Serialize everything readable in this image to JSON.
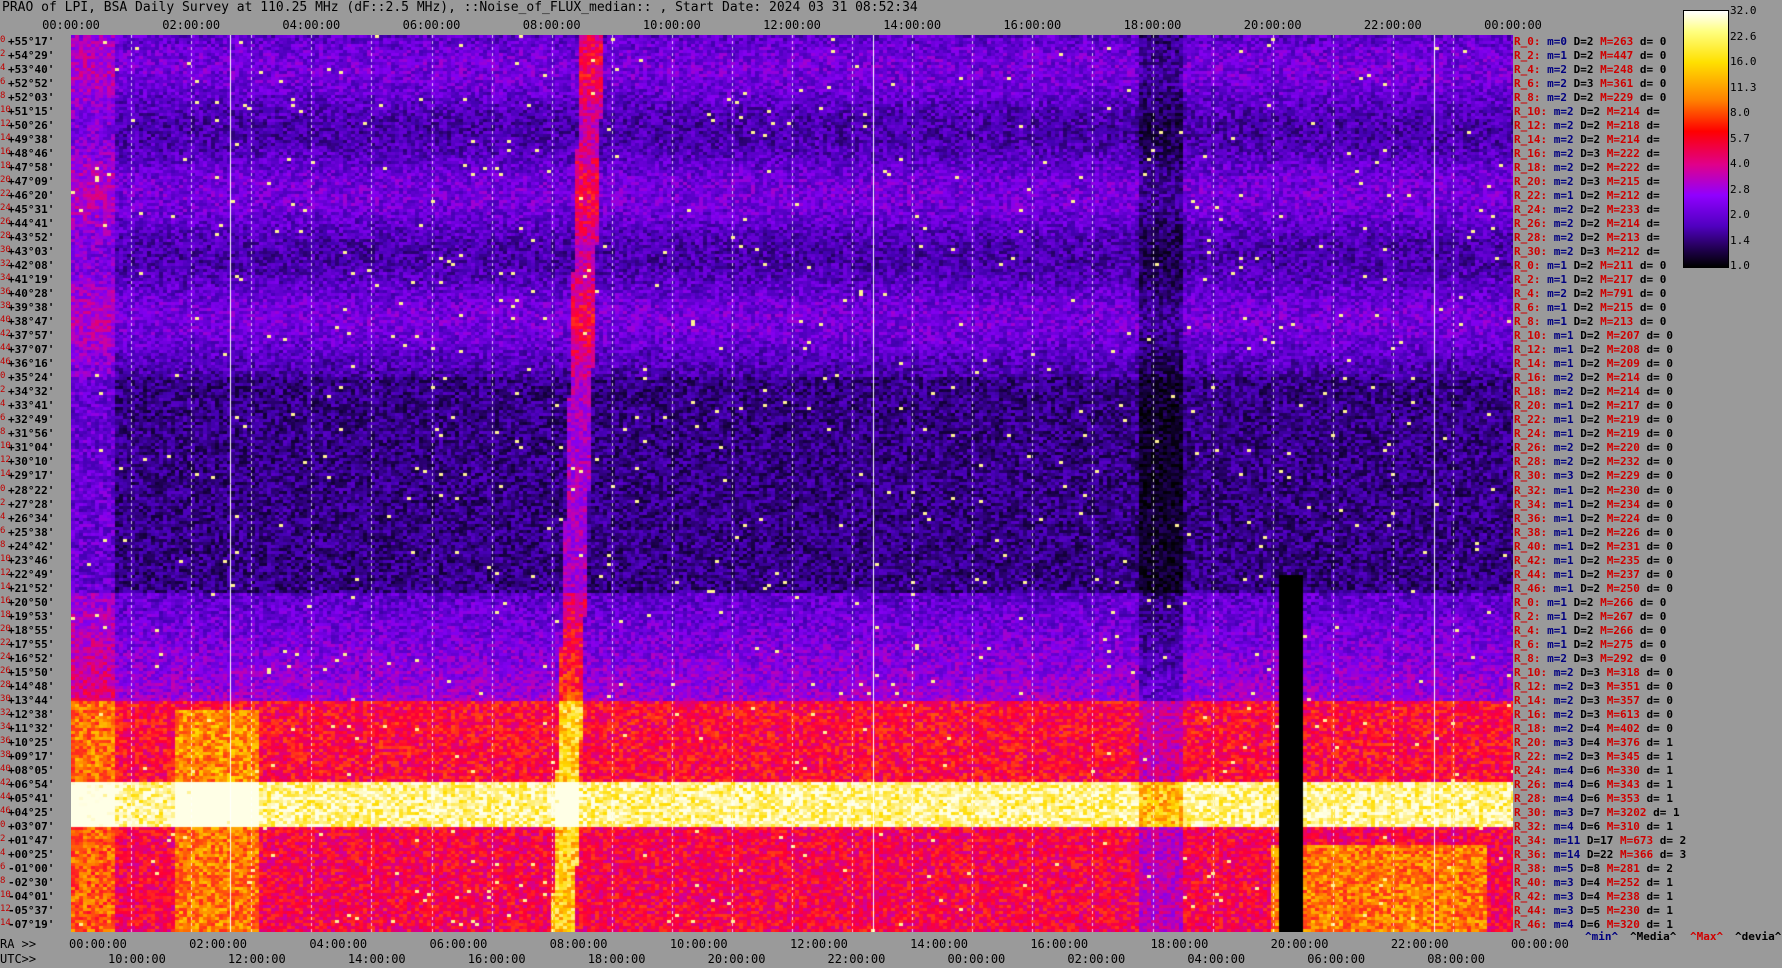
{
  "title": "PRAO of LPI, BSA Daily Survey at 110.25 MHz (dF::2.5 MHz), ::Noise_of_FLUX_median:: , Start Date: 2024 03 31 08:52:34",
  "top_time_ticks": [
    "00:00:00",
    "02:00:00",
    "04:00:00",
    "06:00:00",
    "08:00:00",
    "10:00:00",
    "12:00:00",
    "14:00:00",
    "16:00:00",
    "18:00:00",
    "20:00:00",
    "22:00:00",
    "00:00:00"
  ],
  "ra_label": "RA >>",
  "utc_label": "UTC>>",
  "bottom_ra_ticks": [
    "00:00:00",
    "02:00:00",
    "04:00:00",
    "06:00:00",
    "08:00:00",
    "10:00:00",
    "12:00:00",
    "14:00:00",
    "16:00:00",
    "18:00:00",
    "20:00:00",
    "22:00:00",
    "00:00:00"
  ],
  "bottom_utc_ticks": [
    "10:00:00",
    "12:00:00",
    "14:00:00",
    "16:00:00",
    "18:00:00",
    "20:00:00",
    "22:00:00",
    "00:00:00",
    "02:00:00",
    "04:00:00",
    "06:00:00",
    "08:00:00"
  ],
  "declinations": [
    "+55°17'",
    "+54°29'",
    "+53°40'",
    "+52°52'",
    "+52°03'",
    "+51°15'",
    "+50°26'",
    "+49°38'",
    "+48°46'",
    "+47°58'",
    "+47°09'",
    "+46°20'",
    "+45°31'",
    "+44°41'",
    "+43°52'",
    "+43°03'",
    "+42°08'",
    "+41°19'",
    "+40°28'",
    "+39°38'",
    "+38°47'",
    "+37°57'",
    "+37°07'",
    "+36°16'",
    "+35°24'",
    "+34°32'",
    "+33°41'",
    "+32°49'",
    "+31°56'",
    "+31°04'",
    "+30°10'",
    "+29°17'",
    "+28°22'",
    "+27°28'",
    "+26°34'",
    "+25°38'",
    "+24°42'",
    "+23°46'",
    "+22°49'",
    "+21°52'",
    "+20°50'",
    "+19°53'",
    "+18°55'",
    "+17°55'",
    "+16°52'",
    "+15°50'",
    "+14°48'",
    "+13°44'",
    "+12°38'",
    "+11°32'",
    "+10°25'",
    "+09°17'",
    "+08°05'",
    "+06°54'",
    "+05°41'",
    "+04°25'",
    "+03°07'",
    "+01°47'",
    "+00°25'",
    "-01°00'",
    "-02°30'",
    "-04°01'",
    "-05°37'",
    "-07°19'"
  ],
  "row_stats": [
    {
      "r": "R_0:",
      "m": "m=0",
      "D": "D=2",
      "M": "M=263",
      "d": "d= 0"
    },
    {
      "r": "R_2:",
      "m": "m=1",
      "D": "D=2",
      "M": "M=447",
      "d": "d= 0"
    },
    {
      "r": "R_4:",
      "m": "m=2",
      "D": "D=2",
      "M": "M=248",
      "d": "d= 0"
    },
    {
      "r": "R_6:",
      "m": "m=2",
      "D": "D=3",
      "M": "M=361",
      "d": "d= 0"
    },
    {
      "r": "R_8:",
      "m": "m=2",
      "D": "D=2",
      "M": "M=229",
      "d": "d= 0"
    },
    {
      "r": "R_10:",
      "m": "m=2",
      "D": "D=2",
      "M": "M=214",
      "d": "d="
    },
    {
      "r": "R_12:",
      "m": "m=2",
      "D": "D=2",
      "M": "M=218",
      "d": "d="
    },
    {
      "r": "R_14:",
      "m": "m=2",
      "D": "D=2",
      "M": "M=214",
      "d": "d="
    },
    {
      "r": "R_16:",
      "m": "m=2",
      "D": "D=3",
      "M": "M=222",
      "d": "d="
    },
    {
      "r": "R_18:",
      "m": "m=2",
      "D": "D=2",
      "M": "M=222",
      "d": "d="
    },
    {
      "r": "R_20:",
      "m": "m=2",
      "D": "D=3",
      "M": "M=215",
      "d": "d="
    },
    {
      "r": "R_22:",
      "m": "m=1",
      "D": "D=2",
      "M": "M=212",
      "d": "d="
    },
    {
      "r": "R_24:",
      "m": "m=2",
      "D": "D=2",
      "M": "M=233",
      "d": "d="
    },
    {
      "r": "R_26:",
      "m": "m=2",
      "D": "D=2",
      "M": "M=214",
      "d": "d="
    },
    {
      "r": "R_28:",
      "m": "m=2",
      "D": "D=2",
      "M": "M=213",
      "d": "d="
    },
    {
      "r": "R_30:",
      "m": "m=2",
      "D": "D=3",
      "M": "M=212",
      "d": "d="
    },
    {
      "r": "R_0:",
      "m": "m=1",
      "D": "D=2",
      "M": "M=211",
      "d": "d= 0"
    },
    {
      "r": "R_2:",
      "m": "m=1",
      "D": "D=2",
      "M": "M=217",
      "d": "d= 0"
    },
    {
      "r": "R_4:",
      "m": "m=2",
      "D": "D=2",
      "M": "M=791",
      "d": "d= 0"
    },
    {
      "r": "R_6:",
      "m": "m=1",
      "D": "D=2",
      "M": "M=215",
      "d": "d= 0"
    },
    {
      "r": "R_8:",
      "m": "m=1",
      "D": "D=2",
      "M": "M=213",
      "d": "d= 0"
    },
    {
      "r": "R_10:",
      "m": "m=1",
      "D": "D=2",
      "M": "M=207",
      "d": "d= 0"
    },
    {
      "r": "R_12:",
      "m": "m=1",
      "D": "D=2",
      "M": "M=208",
      "d": "d= 0"
    },
    {
      "r": "R_14:",
      "m": "m=1",
      "D": "D=2",
      "M": "M=209",
      "d": "d= 0"
    },
    {
      "r": "R_16:",
      "m": "m=2",
      "D": "D=2",
      "M": "M=214",
      "d": "d= 0"
    },
    {
      "r": "R_18:",
      "m": "m=2",
      "D": "D=2",
      "M": "M=214",
      "d": "d= 0"
    },
    {
      "r": "R_20:",
      "m": "m=1",
      "D": "D=2",
      "M": "M=217",
      "d": "d= 0"
    },
    {
      "r": "R_22:",
      "m": "m=1",
      "D": "D=2",
      "M": "M=219",
      "d": "d= 0"
    },
    {
      "r": "R_24:",
      "m": "m=1",
      "D": "D=2",
      "M": "M=219",
      "d": "d= 0"
    },
    {
      "r": "R_26:",
      "m": "m=2",
      "D": "D=2",
      "M": "M=220",
      "d": "d= 0"
    },
    {
      "r": "R_28:",
      "m": "m=2",
      "D": "D=2",
      "M": "M=232",
      "d": "d= 0"
    },
    {
      "r": "R_30:",
      "m": "m=3",
      "D": "D=2",
      "M": "M=229",
      "d": "d= 0"
    },
    {
      "r": "R_32:",
      "m": "m=1",
      "D": "D=2",
      "M": "M=230",
      "d": "d= 0"
    },
    {
      "r": "R_34:",
      "m": "m=1",
      "D": "D=2",
      "M": "M=234",
      "d": "d= 0"
    },
    {
      "r": "R_36:",
      "m": "m=1",
      "D": "D=2",
      "M": "M=224",
      "d": "d= 0"
    },
    {
      "r": "R_38:",
      "m": "m=1",
      "D": "D=2",
      "M": "M=226",
      "d": "d= 0"
    },
    {
      "r": "R_40:",
      "m": "m=1",
      "D": "D=2",
      "M": "M=231",
      "d": "d= 0"
    },
    {
      "r": "R_42:",
      "m": "m=1",
      "D": "D=2",
      "M": "M=235",
      "d": "d= 0"
    },
    {
      "r": "R_44:",
      "m": "m=1",
      "D": "D=2",
      "M": "M=237",
      "d": "d= 0"
    },
    {
      "r": "R_46:",
      "m": "m=1",
      "D": "D=2",
      "M": "M=250",
      "d": "d= 0"
    },
    {
      "r": "R_0:",
      "m": "m=1",
      "D": "D=2",
      "M": "M=266",
      "d": "d= 0"
    },
    {
      "r": "R_2:",
      "m": "m=1",
      "D": "D=2",
      "M": "M=267",
      "d": "d= 0"
    },
    {
      "r": "R_4:",
      "m": "m=1",
      "D": "D=2",
      "M": "M=266",
      "d": "d= 0"
    },
    {
      "r": "R_6:",
      "m": "m=1",
      "D": "D=2",
      "M": "M=275",
      "d": "d= 0"
    },
    {
      "r": "R_8:",
      "m": "m=2",
      "D": "D=3",
      "M": "M=292",
      "d": "d= 0"
    },
    {
      "r": "R_10:",
      "m": "m=2",
      "D": "D=3",
      "M": "M=318",
      "d": "d= 0"
    },
    {
      "r": "R_12:",
      "m": "m=2",
      "D": "D=3",
      "M": "M=351",
      "d": "d= 0"
    },
    {
      "r": "R_14:",
      "m": "m=2",
      "D": "D=3",
      "M": "M=357",
      "d": "d= 0"
    },
    {
      "r": "R_16:",
      "m": "m=2",
      "D": "D=3",
      "M": "M=613",
      "d": "d= 0"
    },
    {
      "r": "R_18:",
      "m": "m=2",
      "D": "D=4",
      "M": "M=402",
      "d": "d= 0"
    },
    {
      "r": "R_20:",
      "m": "m=3",
      "D": "D=4",
      "M": "M=376",
      "d": "d= 1"
    },
    {
      "r": "R_22:",
      "m": "m=2",
      "D": "D=3",
      "M": "M=345",
      "d": "d= 1"
    },
    {
      "r": "R_24:",
      "m": "m=4",
      "D": "D=6",
      "M": "M=330",
      "d": "d= 1"
    },
    {
      "r": "R_26:",
      "m": "m=4",
      "D": "D=6",
      "M": "M=343",
      "d": "d= 1"
    },
    {
      "r": "R_28:",
      "m": "m=4",
      "D": "D=6",
      "M": "M=353",
      "d": "d= 1"
    },
    {
      "r": "R_30:",
      "m": "m=3",
      "D": "D=7",
      "M": "M=3202",
      "d": "d= 1"
    },
    {
      "r": "R_32:",
      "m": "m=4",
      "D": "D=6",
      "M": "M=310",
      "d": "d= 1"
    },
    {
      "r": "R_34:",
      "m": "m=11",
      "D": "D=17",
      "M": "M=673",
      "d": "d= 2"
    },
    {
      "r": "R_36:",
      "m": "m=14",
      "D": "D=22",
      "M": "M=366",
      "d": "d= 3"
    },
    {
      "r": "R_38:",
      "m": "m=5",
      "D": "D=8",
      "M": "M=281",
      "d": "d= 2"
    },
    {
      "r": "R_40:",
      "m": "m=3",
      "D": "D=4",
      "M": "M=252",
      "d": "d= 1"
    },
    {
      "r": "R_42:",
      "m": "m=3",
      "D": "D=4",
      "M": "M=238",
      "d": "d= 1"
    },
    {
      "r": "R_44:",
      "m": "m=3",
      "D": "D=5",
      "M": "M=230",
      "d": "d= 1"
    },
    {
      "r": "R_46:",
      "m": "m=4",
      "D": "D=6",
      "M": "M=320",
      "d": "d= 1"
    }
  ],
  "footer": {
    "min": "^min^",
    "median": "^Media^",
    "max": "^Max^",
    "dev": "^devia^"
  },
  "colorbar_ticks": [
    "32.0",
    "22.6",
    "16.0",
    "11.3",
    "8.0",
    "5.7",
    "4.0",
    "2.8",
    "2.0",
    "1.4",
    "1.0"
  ],
  "colors": {
    "background": "#9a9a9a",
    "accent": "#d00000",
    "stat_blue": "#000080"
  }
}
